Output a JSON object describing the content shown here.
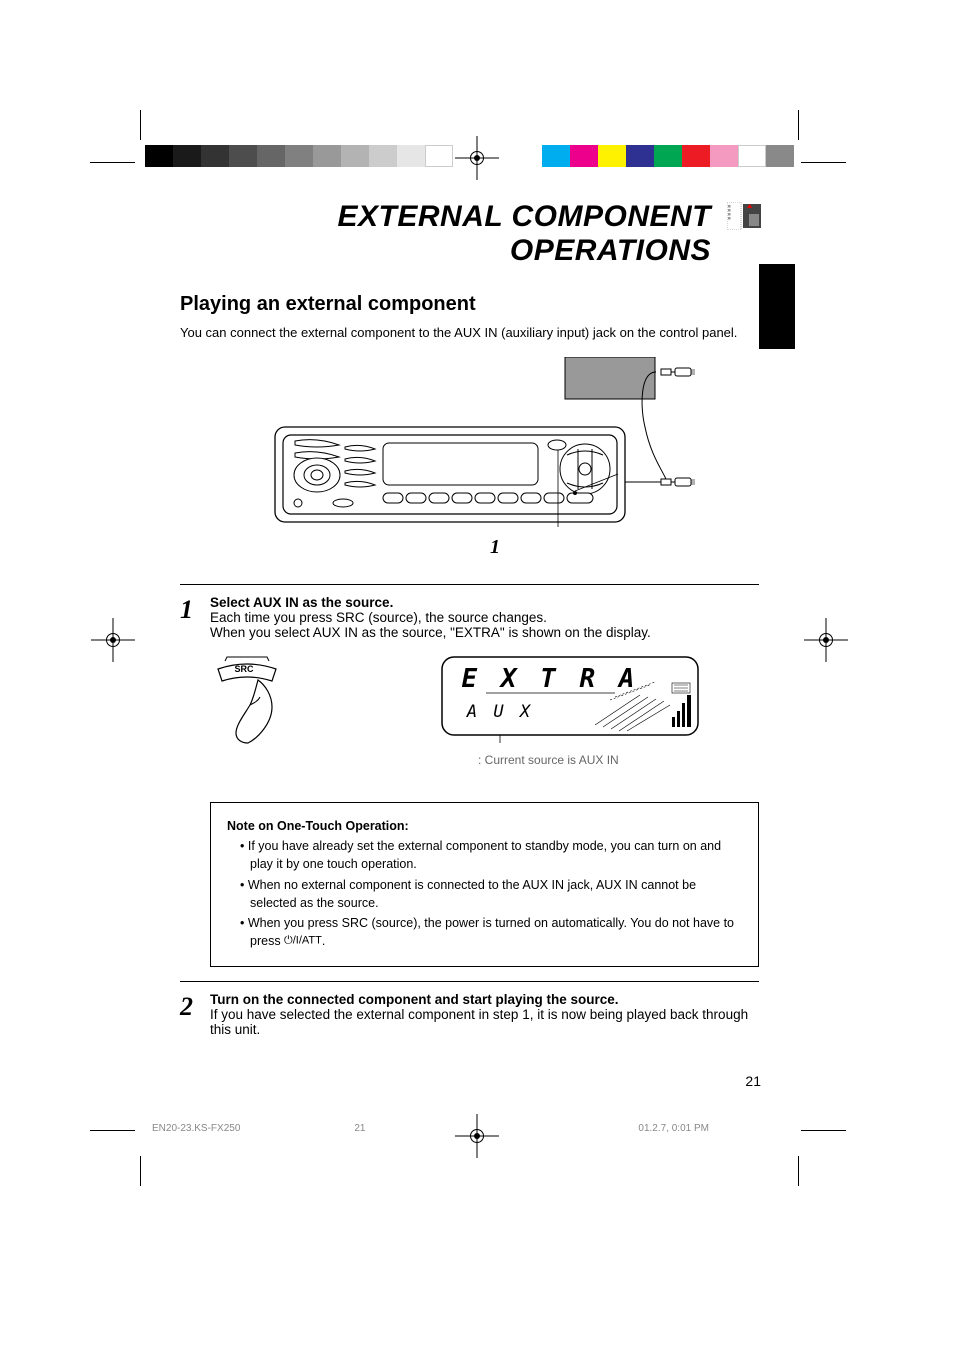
{
  "page": {
    "title": "EXTERNAL COMPONENT OPERATIONS",
    "subtitle": "Playing an external component",
    "subtitle_desc": "You can connect the external component to the AUX IN (auxiliary input) jack on the control panel.",
    "diagram_label": "1",
    "page_number": "21"
  },
  "step1": {
    "num": "1",
    "heading": "Select AUX IN as the source.",
    "line1_a": "Each time you press SRC (source), the source changes.",
    "line1_b": "When you select AUX IN as the source, \"EXTRA\" is shown on the display.",
    "display_main": "EXTRA",
    "display_sub": "AUX",
    "display_point": ": Current source is AUX IN"
  },
  "note": {
    "title": "Note on One-Touch Operation:",
    "items": [
      "If you have already set the external component to standby mode, you can turn on and play it by one touch operation.",
      "When no external component is connected to the AUX IN jack, AUX IN cannot be selected as the source.",
      "When you press SRC (source), the power is turned on automatically. You do not have to press ",
      "."
    ],
    "icon_text": "⏻/I/ATT"
  },
  "step2": {
    "num": "2",
    "line1": "Turn on the connected component and start playing the source.",
    "line2": "If you have selected the external component in step 1, it is now being played back through this unit."
  },
  "footer": {
    "file": "EN20-23.KS-FX250",
    "file_page": "21",
    "date": "01.2.7, 0:01 PM"
  }
}
